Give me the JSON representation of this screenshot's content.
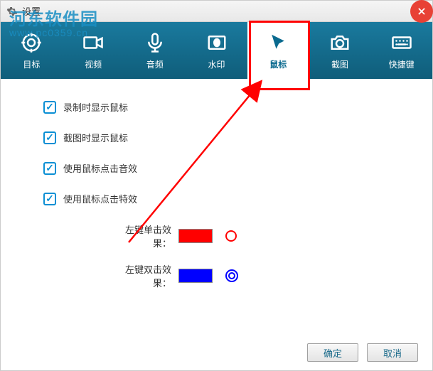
{
  "window": {
    "title": "设置"
  },
  "watermark": {
    "line1": "河东软件园",
    "line2": "www.pc0359.cn"
  },
  "tabs": [
    {
      "label": "目标"
    },
    {
      "label": "视频"
    },
    {
      "label": "音频"
    },
    {
      "label": "水印"
    },
    {
      "label": "鼠标",
      "active": true
    },
    {
      "label": "截图"
    },
    {
      "label": "快捷键"
    }
  ],
  "options": {
    "showMouseRecording": {
      "label": "录制时显示鼠标",
      "checked": true
    },
    "showMouseScreenshot": {
      "label": "截图时显示鼠标",
      "checked": true
    },
    "clickSound": {
      "label": "使用鼠标点击音效",
      "checked": true
    },
    "clickEffect": {
      "label": "使用鼠标点击特效",
      "checked": true
    }
  },
  "effects": {
    "singleClick": {
      "label": "左键单击效果：",
      "color": "#ff0000"
    },
    "doubleClick": {
      "label": "左键双击效果：",
      "color": "#0000ff"
    }
  },
  "buttons": {
    "ok": "确定",
    "cancel": "取消"
  }
}
